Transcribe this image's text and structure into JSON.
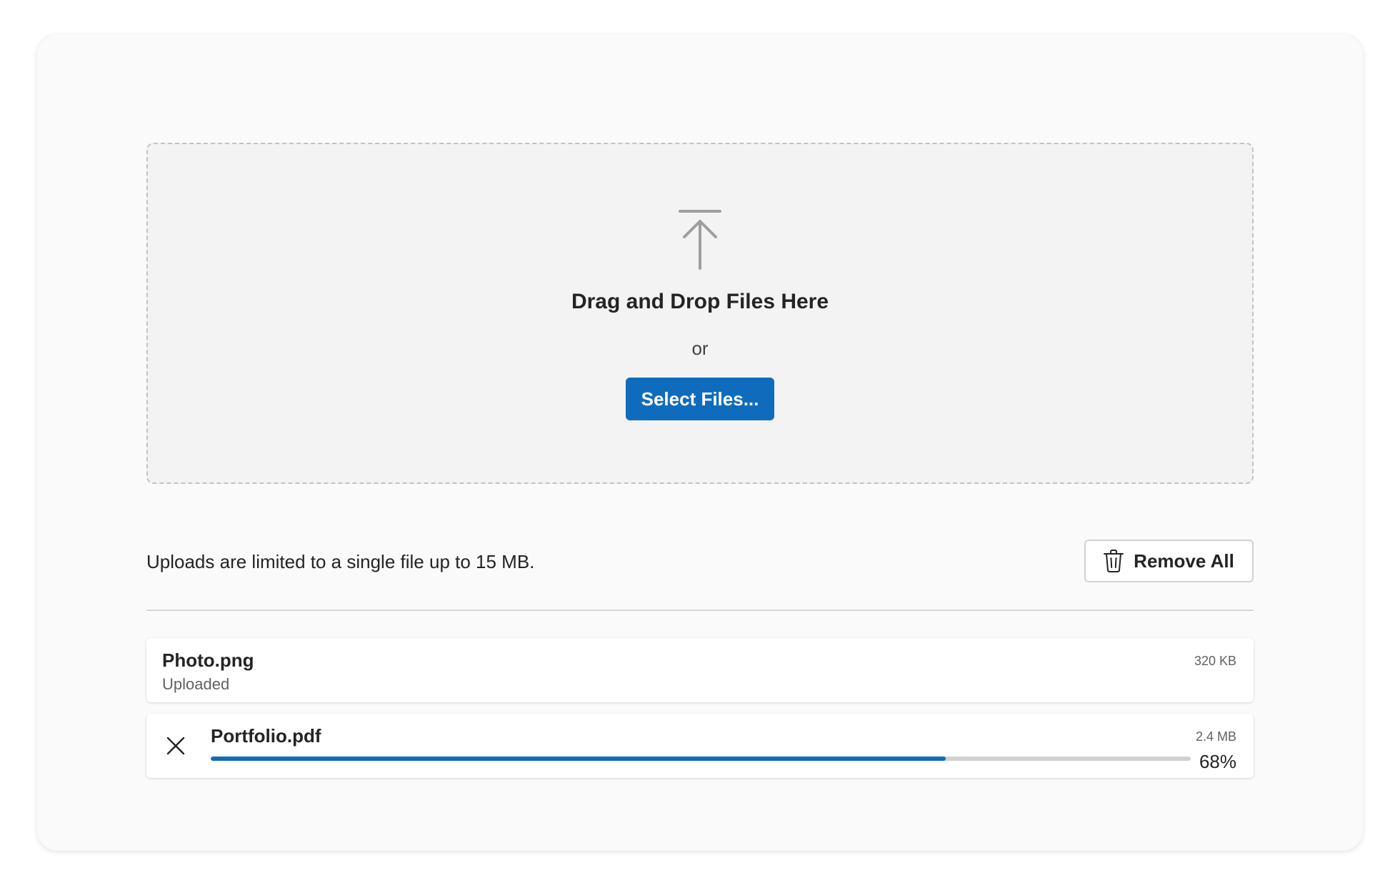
{
  "dropzone": {
    "title": "Drag and Drop Files Here",
    "or_text": "or",
    "select_button_label": "Select Files..."
  },
  "info": {
    "limit_text": "Uploads are limited to a single file up to 15 MB.",
    "remove_all_label": "Remove All"
  },
  "files": [
    {
      "name": "Photo.png",
      "status": "Uploaded",
      "size": "320 KB"
    },
    {
      "name": "Portfolio.pdf",
      "size": "2.4 MB",
      "progress": 0.75,
      "progress_label": "68%"
    }
  ],
  "colors": {
    "accent": "#0f6cbd",
    "text": "#242424",
    "muted": "#616161",
    "icon_gray": "#9e9e9e"
  },
  "icons": {
    "upload": "upload-arrow-icon",
    "trash": "trash-icon",
    "close": "close-icon"
  }
}
